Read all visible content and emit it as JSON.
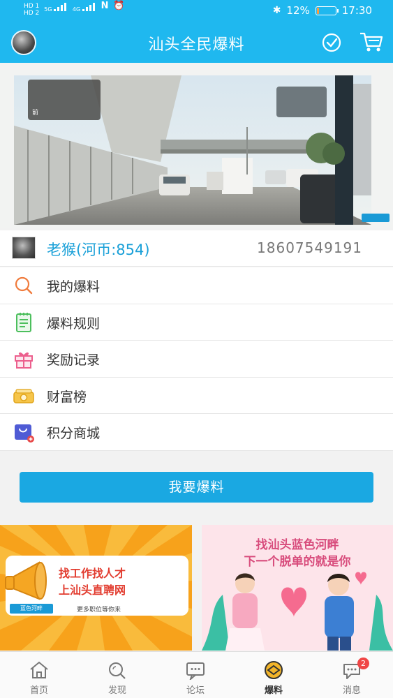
{
  "status_bar": {
    "left_line1": "HD 1",
    "left_line2": "HD 2",
    "network_type": "5G",
    "network_type2": "4G",
    "battery_level": 0.12,
    "battery_text": "12%",
    "time": "17:30"
  },
  "app_bar": {
    "title": "汕头全民爆料"
  },
  "banner": {
    "dashcam_label": "前"
  },
  "user": {
    "name": "老猴(河币:854)",
    "phone": "18607549191"
  },
  "menu": [
    {
      "label": "我的爆料",
      "icon": "search-icon"
    },
    {
      "label": "爆料规则",
      "icon": "notepad-icon"
    },
    {
      "label": "奖励记录",
      "icon": "gift-icon"
    },
    {
      "label": "财富榜",
      "icon": "money-icon"
    },
    {
      "label": "积分商城",
      "icon": "shopping-bag-icon"
    }
  ],
  "cta": {
    "label": "我要爆料"
  },
  "ads": {
    "left": {
      "line1": "找工作找人才",
      "line2": "上汕头直聘网",
      "tag": "蓝色河畔",
      "small": "更多职位等你来"
    },
    "right": {
      "line1": "找汕头蓝色河畔",
      "line2": "下一个脱单的就是你"
    }
  },
  "tabs": [
    {
      "label": "首页",
      "icon": "home-icon"
    },
    {
      "label": "发现",
      "icon": "discover-icon"
    },
    {
      "label": "论坛",
      "icon": "forum-icon"
    },
    {
      "label": "爆料",
      "icon": "report-icon",
      "active": true
    },
    {
      "label": "消息",
      "icon": "message-icon",
      "badge": "2"
    }
  ],
  "colors": {
    "primary": "#1fb8ef",
    "cta": "#1aa8e2",
    "badge": "#f04646"
  }
}
